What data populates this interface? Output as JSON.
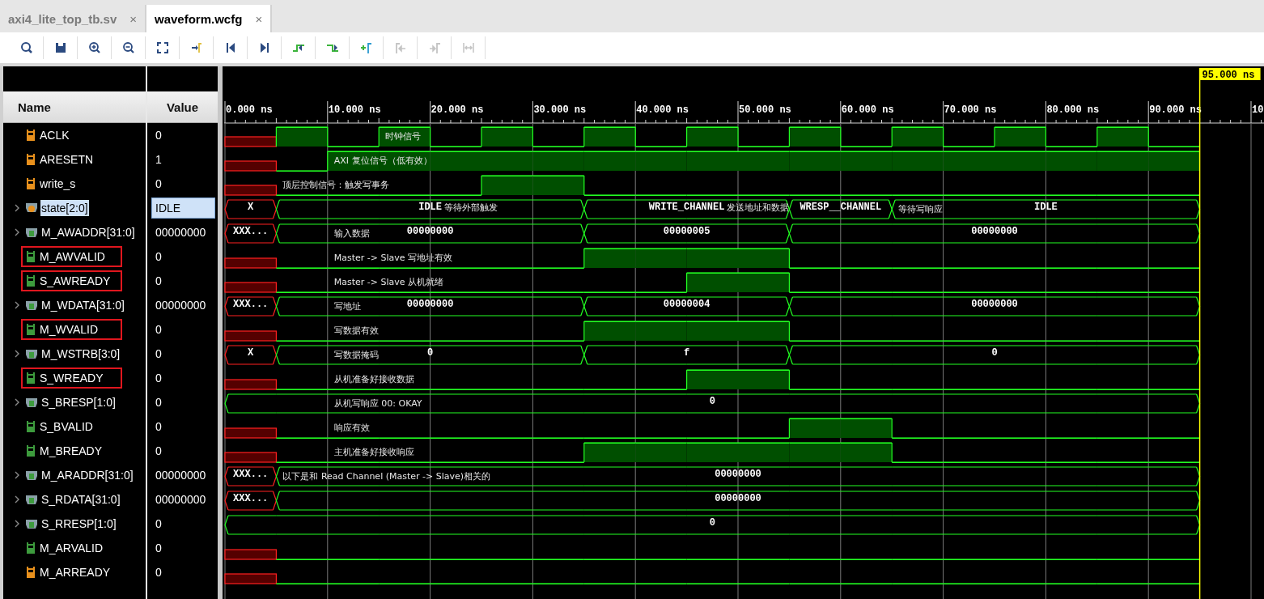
{
  "tabs": [
    {
      "label": "axi4_lite_top_tb.sv",
      "close": "×",
      "selected": false
    },
    {
      "label": "waveform.wcfg",
      "close": "×",
      "selected": true
    }
  ],
  "toolbar": [
    {
      "kind": "search",
      "disabled": false
    },
    {
      "kind": "save",
      "disabled": false
    },
    {
      "kind": "zoom-in",
      "disabled": false
    },
    {
      "kind": "zoom-out",
      "disabled": false
    },
    {
      "kind": "zoom-fit",
      "disabled": false
    },
    {
      "kind": "go-to-cursor",
      "disabled": false
    },
    {
      "kind": "go-to-start",
      "disabled": false
    },
    {
      "kind": "go-to-end",
      "disabled": false
    },
    {
      "kind": "previous-transition",
      "disabled": false
    },
    {
      "kind": "next-transition",
      "disabled": false
    },
    {
      "kind": "add-marker",
      "disabled": false
    },
    {
      "kind": "previous-marker",
      "disabled": true
    },
    {
      "kind": "next-marker",
      "disabled": true
    },
    {
      "kind": "swap-markers",
      "disabled": true
    }
  ],
  "columns": {
    "name": "Name",
    "value": "Value"
  },
  "signals": [
    {
      "name": "ACLK",
      "value": "0",
      "kind": "bit",
      "color": "#e8901c",
      "selected": false,
      "highlighted": false
    },
    {
      "name": "ARESETN",
      "value": "1",
      "kind": "bit",
      "color": "#e8901c",
      "selected": false,
      "highlighted": false
    },
    {
      "name": "write_s",
      "value": "0",
      "kind": "bit",
      "color": "#e8901c",
      "selected": false,
      "highlighted": false
    },
    {
      "name": "state[2:0]",
      "value": "IDLE",
      "kind": "enum",
      "color": "#e8901c",
      "selected": true,
      "highlighted": false
    },
    {
      "name": "M_AWADDR[31:0]",
      "value": "00000000",
      "kind": "bus",
      "color": "#3d9b3d",
      "selected": false,
      "highlighted": false
    },
    {
      "name": "M_AWVALID",
      "value": "0",
      "kind": "bit",
      "color": "#3d9b3d",
      "selected": false,
      "highlighted": true
    },
    {
      "name": "S_AWREADY",
      "value": "0",
      "kind": "bit",
      "color": "#3d9b3d",
      "selected": false,
      "highlighted": true
    },
    {
      "name": "M_WDATA[31:0]",
      "value": "00000000",
      "kind": "bus",
      "color": "#3d9b3d",
      "selected": false,
      "highlighted": false
    },
    {
      "name": "M_WVALID",
      "value": "0",
      "kind": "bit",
      "color": "#3d9b3d",
      "selected": false,
      "highlighted": true
    },
    {
      "name": "M_WSTRB[3:0]",
      "value": "0",
      "kind": "bus",
      "color": "#3d9b3d",
      "selected": false,
      "highlighted": false
    },
    {
      "name": "S_WREADY",
      "value": "0",
      "kind": "bit",
      "color": "#3d9b3d",
      "selected": false,
      "highlighted": true
    },
    {
      "name": "S_BRESP[1:0]",
      "value": "0",
      "kind": "bus",
      "color": "#3d9b3d",
      "selected": false,
      "highlighted": false
    },
    {
      "name": "S_BVALID",
      "value": "0",
      "kind": "bit",
      "color": "#3d9b3d",
      "selected": false,
      "highlighted": false
    },
    {
      "name": "M_BREADY",
      "value": "0",
      "kind": "bit",
      "color": "#3d9b3d",
      "selected": false,
      "highlighted": false
    },
    {
      "name": "M_ARADDR[31:0]",
      "value": "00000000",
      "kind": "bus",
      "color": "#3d9b3d",
      "selected": false,
      "highlighted": false
    },
    {
      "name": "S_RDATA[31:0]",
      "value": "00000000",
      "kind": "bus",
      "color": "#3d9b3d",
      "selected": false,
      "highlighted": false
    },
    {
      "name": "S_RRESP[1:0]",
      "value": "0",
      "kind": "bus",
      "color": "#3d9b3d",
      "selected": false,
      "highlighted": false
    },
    {
      "name": "M_ARVALID",
      "value": "0",
      "kind": "bit",
      "color": "#3d9b3d",
      "selected": false,
      "highlighted": false
    },
    {
      "name": "M_ARREADY",
      "value": "0",
      "kind": "bit",
      "color": "#e8901c",
      "selected": false,
      "highlighted": false
    }
  ],
  "waveform": {
    "ticks": [
      "0.000 ns",
      "10.000 ns",
      "20.000 ns",
      "30.000 ns",
      "40.000 ns",
      "50.000 ns",
      "60.000 ns",
      "70.000 ns",
      "80.000 ns",
      "90.000 ns",
      "10"
    ],
    "cursor": "95.000 ns",
    "rows": [
      {
        "kind": "bit",
        "slots": [
          {
            "high": false,
            "unknown": true
          },
          {
            "high": true,
            "unknown": false
          },
          {
            "high": false,
            "unknown": false
          },
          {
            "high": true,
            "unknown": false,
            "note": "时钟信号"
          },
          {
            "high": false,
            "unknown": false
          },
          {
            "high": true,
            "unknown": false
          },
          {
            "high": false,
            "unknown": false
          },
          {
            "high": true,
            "unknown": false
          },
          {
            "high": false,
            "unknown": false
          },
          {
            "high": true,
            "unknown": false
          },
          {
            "high": false,
            "unknown": false
          },
          {
            "high": true,
            "unknown": false
          },
          {
            "high": false,
            "unknown": false
          },
          {
            "high": true,
            "unknown": false
          },
          {
            "high": false,
            "unknown": false
          },
          {
            "high": true,
            "unknown": false
          },
          {
            "high": false,
            "unknown": false
          },
          {
            "high": true,
            "unknown": false
          },
          {
            "high": false,
            "unknown": false
          }
        ]
      },
      {
        "kind": "bit",
        "slots": [
          {
            "high": false,
            "unknown": true
          },
          {
            "high": false,
            "unknown": false
          },
          {
            "high": true,
            "unknown": false,
            "note": "AXI 复位信号（低有效）"
          },
          {
            "high": true,
            "unknown": false
          },
          {
            "high": true,
            "unknown": false
          },
          {
            "high": true,
            "unknown": false
          },
          {
            "high": true,
            "unknown": false
          },
          {
            "high": true,
            "unknown": false
          },
          {
            "high": true,
            "unknown": false
          },
          {
            "high": true,
            "unknown": false
          },
          {
            "high": true,
            "unknown": false
          },
          {
            "high": true,
            "unknown": false
          },
          {
            "high": true,
            "unknown": false
          },
          {
            "high": true,
            "unknown": false
          },
          {
            "high": true,
            "unknown": false
          },
          {
            "high": true,
            "unknown": false
          },
          {
            "high": true,
            "unknown": false
          },
          {
            "high": true,
            "unknown": false
          },
          {
            "high": true,
            "unknown": false
          }
        ]
      },
      {
        "kind": "bit",
        "slots": [
          {
            "high": false,
            "unknown": true
          },
          {
            "high": false,
            "unknown": false,
            "note": "顶层控制信号：触发写事务"
          },
          {
            "high": false,
            "unknown": false
          },
          {
            "high": false,
            "unknown": false
          },
          {
            "high": false,
            "unknown": false
          },
          {
            "high": true,
            "unknown": false
          },
          {
            "high": true,
            "unknown": false
          },
          {
            "high": false,
            "unknown": false
          },
          {
            "high": false,
            "unknown": false
          },
          {
            "high": false,
            "unknown": false
          },
          {
            "high": false,
            "unknown": false
          },
          {
            "high": false,
            "unknown": false
          },
          {
            "high": false,
            "unknown": false
          },
          {
            "high": false,
            "unknown": false
          },
          {
            "high": false,
            "unknown": false
          },
          {
            "high": false,
            "unknown": false
          },
          {
            "high": false,
            "unknown": false
          },
          {
            "high": false,
            "unknown": false
          },
          {
            "high": false,
            "unknown": false
          }
        ]
      },
      {
        "kind": "bus",
        "slots": [
          {
            "start": true
          },
          {
            "start": true
          },
          {
            "start": false
          },
          {
            "start": false
          },
          {
            "start": false
          },
          {
            "start": false
          },
          {
            "start": false
          },
          {
            "start": true
          },
          {
            "start": false
          },
          {
            "start": false
          },
          {
            "start": false
          },
          {
            "start": true
          },
          {
            "start": false
          },
          {
            "start": true,
            "note": "等待写响应"
          },
          {
            "start": false
          },
          {
            "start": false
          },
          {
            "start": false
          },
          {
            "start": false
          },
          {
            "start": false
          }
        ],
        "segments": [
          {
            "label": "X",
            "unknown": true
          },
          {
            "label": "IDLE",
            "unknown": false,
            "note": "等待外部触发"
          },
          {
            "label": "WRITE_CHANNEL",
            "unknown": false,
            "note": "发送地址和数据"
          },
          {
            "label": "WRESP__CHANNEL",
            "unknown": false
          },
          {
            "label": "IDLE",
            "unknown": false
          }
        ]
      },
      {
        "kind": "bus",
        "slots": [
          {
            "start": true
          },
          {
            "start": true
          },
          {
            "start": false,
            "note": "输入数据"
          },
          {
            "start": false
          },
          {
            "start": false
          },
          {
            "start": false
          },
          {
            "start": false
          },
          {
            "start": true
          },
          {
            "start": false
          },
          {
            "start": false
          },
          {
            "start": false
          },
          {
            "start": true
          },
          {
            "start": false
          },
          {
            "start": false
          },
          {
            "start": false
          },
          {
            "start": false
          },
          {
            "start": false
          },
          {
            "start": false
          },
          {
            "start": false
          }
        ],
        "segments": [
          {
            "label": "XXX...",
            "unknown": true
          },
          {
            "label": "00000000",
            "unknown": false
          },
          {
            "label": "00000005",
            "unknown": false
          },
          {
            "label": "00000000",
            "unknown": false
          }
        ]
      },
      {
        "kind": "bit",
        "slots": [
          {
            "high": false,
            "unknown": true
          },
          {
            "high": false,
            "unknown": false
          },
          {
            "high": false,
            "unknown": false,
            "note": "Master -> Slave 写地址有效"
          },
          {
            "high": false,
            "unknown": false
          },
          {
            "high": false,
            "unknown": false
          },
          {
            "high": false,
            "unknown": false
          },
          {
            "high": false,
            "unknown": false
          },
          {
            "high": true,
            "unknown": false
          },
          {
            "high": true,
            "unknown": false
          },
          {
            "high": true,
            "unknown": false
          },
          {
            "high": true,
            "unknown": false
          },
          {
            "high": false,
            "unknown": false
          },
          {
            "high": false,
            "unknown": false
          },
          {
            "high": false,
            "unknown": false
          },
          {
            "high": false,
            "unknown": false
          },
          {
            "high": false,
            "unknown": false
          },
          {
            "high": false,
            "unknown": false
          },
          {
            "high": false,
            "unknown": false
          },
          {
            "high": false,
            "unknown": false
          }
        ]
      },
      {
        "kind": "bit",
        "slots": [
          {
            "high": false,
            "unknown": true
          },
          {
            "high": false,
            "unknown": false
          },
          {
            "high": false,
            "unknown": false,
            "note": "Master -> Slave 从机就绪"
          },
          {
            "high": false,
            "unknown": false
          },
          {
            "high": false,
            "unknown": false
          },
          {
            "high": false,
            "unknown": false
          },
          {
            "high": false,
            "unknown": false
          },
          {
            "high": false,
            "unknown": false
          },
          {
            "high": false,
            "unknown": false
          },
          {
            "high": true,
            "unknown": false
          },
          {
            "high": true,
            "unknown": false
          },
          {
            "high": false,
            "unknown": false
          },
          {
            "high": false,
            "unknown": false
          },
          {
            "high": false,
            "unknown": false
          },
          {
            "high": false,
            "unknown": false
          },
          {
            "high": false,
            "unknown": false
          },
          {
            "high": false,
            "unknown": false
          },
          {
            "high": false,
            "unknown": false
          },
          {
            "high": false,
            "unknown": false
          }
        ]
      },
      {
        "kind": "bus",
        "slots": [
          {
            "start": true
          },
          {
            "start": true
          },
          {
            "start": false,
            "note": "写地址"
          },
          {
            "start": false
          },
          {
            "start": false
          },
          {
            "start": false
          },
          {
            "start": false
          },
          {
            "start": true
          },
          {
            "start": false
          },
          {
            "start": false
          },
          {
            "start": false
          },
          {
            "start": true
          },
          {
            "start": false
          },
          {
            "start": false
          },
          {
            "start": false
          },
          {
            "start": false
          },
          {
            "start": false
          },
          {
            "start": false
          },
          {
            "start": false
          }
        ],
        "segments": [
          {
            "label": "XXX...",
            "unknown": true
          },
          {
            "label": "00000000",
            "unknown": false
          },
          {
            "label": "00000004",
            "unknown": false
          },
          {
            "label": "00000000",
            "unknown": false
          }
        ]
      },
      {
        "kind": "bit",
        "slots": [
          {
            "high": false,
            "unknown": true
          },
          {
            "high": false,
            "unknown": false
          },
          {
            "high": false,
            "unknown": false,
            "note": "写数据有效"
          },
          {
            "high": false,
            "unknown": false
          },
          {
            "high": false,
            "unknown": false
          },
          {
            "high": false,
            "unknown": false
          },
          {
            "high": false,
            "unknown": false
          },
          {
            "high": true,
            "unknown": false
          },
          {
            "high": true,
            "unknown": false
          },
          {
            "high": true,
            "unknown": false
          },
          {
            "high": true,
            "unknown": false
          },
          {
            "high": false,
            "unknown": false
          },
          {
            "high": false,
            "unknown": false
          },
          {
            "high": false,
            "unknown": false
          },
          {
            "high": false,
            "unknown": false
          },
          {
            "high": false,
            "unknown": false
          },
          {
            "high": false,
            "unknown": false
          },
          {
            "high": false,
            "unknown": false
          },
          {
            "high": false,
            "unknown": false
          }
        ]
      },
      {
        "kind": "bus",
        "slots": [
          {
            "start": true
          },
          {
            "start": true
          },
          {
            "start": false,
            "note": "写数据掩码"
          },
          {
            "start": false
          },
          {
            "start": false
          },
          {
            "start": false
          },
          {
            "start": false
          },
          {
            "start": true
          },
          {
            "start": false
          },
          {
            "start": false
          },
          {
            "start": false
          },
          {
            "start": true
          },
          {
            "start": false
          },
          {
            "start": false
          },
          {
            "start": false
          },
          {
            "start": false
          },
          {
            "start": false
          },
          {
            "start": false
          },
          {
            "start": false
          }
        ],
        "segments": [
          {
            "label": "X",
            "unknown": true
          },
          {
            "label": "0",
            "unknown": false
          },
          {
            "label": "f",
            "unknown": false
          },
          {
            "label": "0",
            "unknown": false
          }
        ]
      },
      {
        "kind": "bit",
        "slots": [
          {
            "high": false,
            "unknown": true
          },
          {
            "high": false,
            "unknown": false
          },
          {
            "high": false,
            "unknown": false,
            "note": "从机准备好接收数据"
          },
          {
            "high": false,
            "unknown": false
          },
          {
            "high": false,
            "unknown": false
          },
          {
            "high": false,
            "unknown": false
          },
          {
            "high": false,
            "unknown": false
          },
          {
            "high": false,
            "unknown": false
          },
          {
            "high": false,
            "unknown": false
          },
          {
            "high": true,
            "unknown": false
          },
          {
            "high": true,
            "unknown": false
          },
          {
            "high": false,
            "unknown": false
          },
          {
            "high": false,
            "unknown": false
          },
          {
            "high": false,
            "unknown": false
          },
          {
            "high": false,
            "unknown": false
          },
          {
            "high": false,
            "unknown": false
          },
          {
            "high": false,
            "unknown": false
          },
          {
            "high": false,
            "unknown": false
          },
          {
            "high": false,
            "unknown": false
          }
        ]
      },
      {
        "kind": "bus",
        "slots": [
          {
            "start": true
          },
          {
            "start": false
          },
          {
            "start": false,
            "note": "从机写响应 00: OKAY"
          },
          {
            "start": false
          },
          {
            "start": false
          },
          {
            "start": false
          },
          {
            "start": false
          },
          {
            "start": false
          },
          {
            "start": false
          },
          {
            "start": false
          },
          {
            "start": false
          },
          {
            "start": false
          },
          {
            "start": false
          },
          {
            "start": false
          },
          {
            "start": false
          },
          {
            "start": false
          },
          {
            "start": false
          },
          {
            "start": false
          },
          {
            "start": false
          }
        ],
        "segments": [
          {
            "label": "0",
            "unknown": false
          }
        ]
      },
      {
        "kind": "bit",
        "slots": [
          {
            "high": false,
            "unknown": true
          },
          {
            "high": false,
            "unknown": false
          },
          {
            "high": false,
            "unknown": false,
            "note": "响应有效"
          },
          {
            "high": false,
            "unknown": false
          },
          {
            "high": false,
            "unknown": false
          },
          {
            "high": false,
            "unknown": false
          },
          {
            "high": false,
            "unknown": false
          },
          {
            "high": false,
            "unknown": false
          },
          {
            "high": false,
            "unknown": false
          },
          {
            "high": false,
            "unknown": false
          },
          {
            "high": false,
            "unknown": false
          },
          {
            "high": true,
            "unknown": false
          },
          {
            "high": true,
            "unknown": false
          },
          {
            "high": false,
            "unknown": false
          },
          {
            "high": false,
            "unknown": false
          },
          {
            "high": false,
            "unknown": false
          },
          {
            "high": false,
            "unknown": false
          },
          {
            "high": false,
            "unknown": false
          },
          {
            "high": false,
            "unknown": false
          }
        ]
      },
      {
        "kind": "bit",
        "slots": [
          {
            "high": false,
            "unknown": true
          },
          {
            "high": false,
            "unknown": false
          },
          {
            "high": false,
            "unknown": false,
            "note": "主机准备好接收响应"
          },
          {
            "high": false,
            "unknown": false
          },
          {
            "high": false,
            "unknown": false
          },
          {
            "high": false,
            "unknown": false
          },
          {
            "high": false,
            "unknown": false
          },
          {
            "high": true,
            "unknown": false
          },
          {
            "high": true,
            "unknown": false
          },
          {
            "high": true,
            "unknown": false
          },
          {
            "high": true,
            "unknown": false
          },
          {
            "high": true,
            "unknown": false
          },
          {
            "high": true,
            "unknown": false
          },
          {
            "high": false,
            "unknown": false
          },
          {
            "high": false,
            "unknown": false
          },
          {
            "high": false,
            "unknown": false
          },
          {
            "high": false,
            "unknown": false
          },
          {
            "high": false,
            "unknown": false
          },
          {
            "high": false,
            "unknown": false
          }
        ]
      },
      {
        "kind": "bus",
        "slots": [
          {
            "start": true
          },
          {
            "start": true,
            "note": "以下是和 Read Channel (Master -> Slave)相关的"
          },
          {
            "start": false
          },
          {
            "start": false
          },
          {
            "start": false
          },
          {
            "start": false
          },
          {
            "start": false
          },
          {
            "start": false
          },
          {
            "start": false
          },
          {
            "start": false
          },
          {
            "start": false
          },
          {
            "start": false
          },
          {
            "start": false
          },
          {
            "start": false
          },
          {
            "start": false
          },
          {
            "start": false
          },
          {
            "start": false
          },
          {
            "start": false
          },
          {
            "start": false
          }
        ],
        "segments": [
          {
            "label": "XXX...",
            "unknown": true
          },
          {
            "label": "00000000",
            "unknown": false
          }
        ]
      },
      {
        "kind": "bus",
        "slots": [
          {
            "start": true
          },
          {
            "start": true
          },
          {
            "start": false
          },
          {
            "start": false
          },
          {
            "start": false
          },
          {
            "start": false
          },
          {
            "start": false
          },
          {
            "start": false
          },
          {
            "start": false
          },
          {
            "start": false
          },
          {
            "start": false
          },
          {
            "start": false
          },
          {
            "start": false
          },
          {
            "start": false
          },
          {
            "start": false
          },
          {
            "start": false
          },
          {
            "start": false
          },
          {
            "start": false
          },
          {
            "start": false
          }
        ],
        "segments": [
          {
            "label": "XXX...",
            "unknown": true
          },
          {
            "label": "00000000",
            "unknown": false
          }
        ]
      },
      {
        "kind": "bus",
        "slots": [
          {
            "start": true
          },
          {
            "start": false
          },
          {
            "start": false
          },
          {
            "start": false
          },
          {
            "start": false
          },
          {
            "start": false
          },
          {
            "start": false
          },
          {
            "start": false
          },
          {
            "start": false
          },
          {
            "start": false
          },
          {
            "start": false
          },
          {
            "start": false
          },
          {
            "start": false
          },
          {
            "start": false
          },
          {
            "start": false
          },
          {
            "start": false
          },
          {
            "start": false
          },
          {
            "start": false
          },
          {
            "start": false
          }
        ],
        "segments": [
          {
            "label": "0",
            "unknown": false
          }
        ]
      },
      {
        "kind": "bit",
        "slots": [
          {
            "high": false,
            "unknown": true
          },
          {
            "high": false,
            "unknown": false
          },
          {
            "high": false,
            "unknown": false
          },
          {
            "high": false,
            "unknown": false
          },
          {
            "high": false,
            "unknown": false
          },
          {
            "high": false,
            "unknown": false
          },
          {
            "high": false,
            "unknown": false
          },
          {
            "high": false,
            "unknown": false
          },
          {
            "high": false,
            "unknown": false
          },
          {
            "high": false,
            "unknown": false
          },
          {
            "high": false,
            "unknown": false
          },
          {
            "high": false,
            "unknown": false
          },
          {
            "high": false,
            "unknown": false
          },
          {
            "high": false,
            "unknown": false
          },
          {
            "high": false,
            "unknown": false
          },
          {
            "high": false,
            "unknown": false
          },
          {
            "high": false,
            "unknown": false
          },
          {
            "high": false,
            "unknown": false
          },
          {
            "high": false,
            "unknown": false
          }
        ]
      },
      {
        "kind": "bit",
        "slots": [
          {
            "high": false,
            "unknown": true
          },
          {
            "high": false,
            "unknown": false
          },
          {
            "high": false,
            "unknown": false
          },
          {
            "high": false,
            "unknown": false
          },
          {
            "high": false,
            "unknown": false
          },
          {
            "high": false,
            "unknown": false
          },
          {
            "high": false,
            "unknown": false
          },
          {
            "high": false,
            "unknown": false
          },
          {
            "high": false,
            "unknown": false
          },
          {
            "high": false,
            "unknown": false
          },
          {
            "high": false,
            "unknown": false
          },
          {
            "high": false,
            "unknown": false
          },
          {
            "high": false,
            "unknown": false
          },
          {
            "high": false,
            "unknown": false
          },
          {
            "high": false,
            "unknown": false
          },
          {
            "high": false,
            "unknown": false
          },
          {
            "high": false,
            "unknown": false
          },
          {
            "high": false,
            "unknown": false
          },
          {
            "high": false,
            "unknown": false
          }
        ]
      }
    ]
  }
}
